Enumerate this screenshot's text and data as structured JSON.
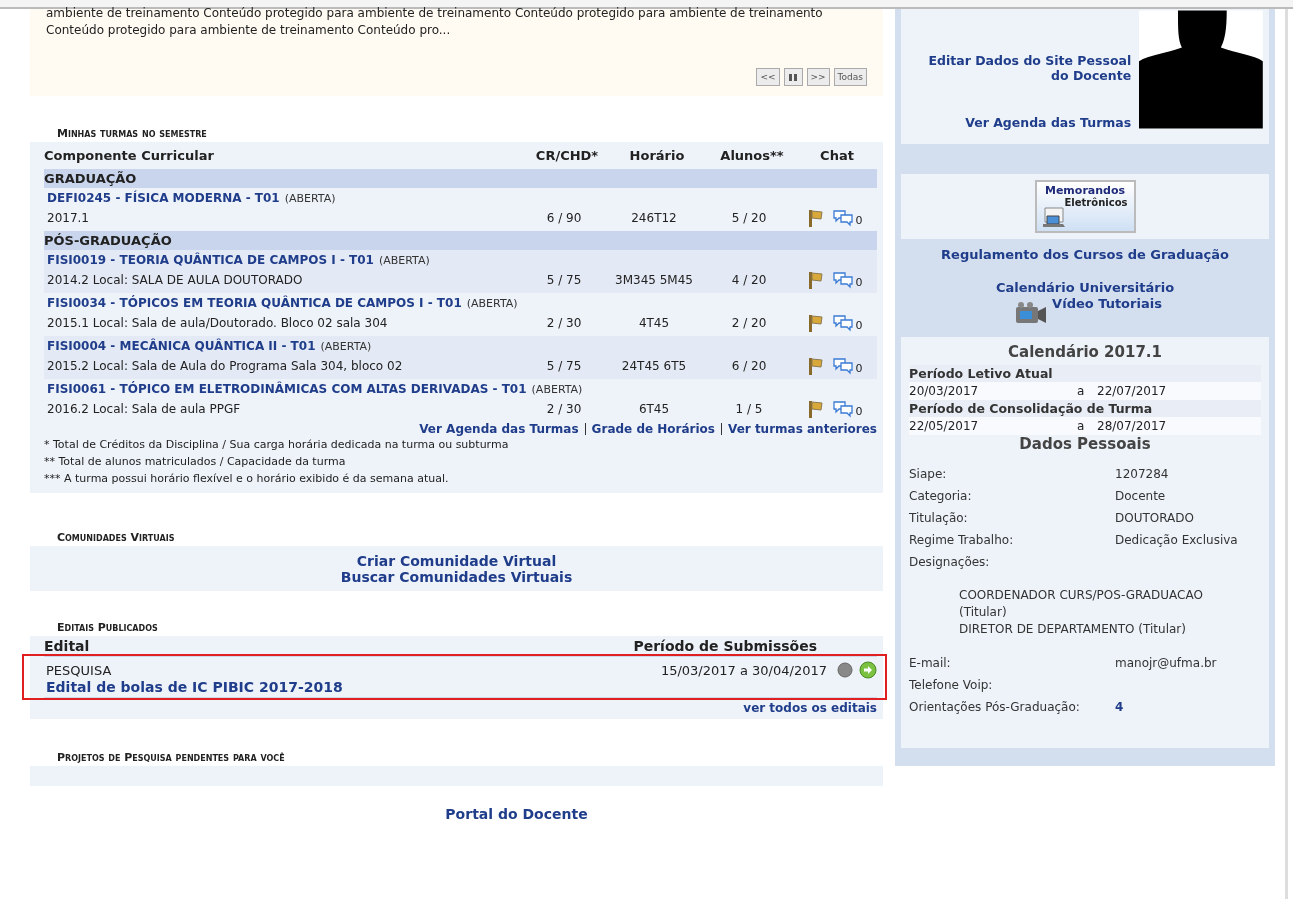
{
  "news": {
    "lines": [
      "ambiente de treinamento Conteúdo protegido para ambiente de treinamento Conteúdo protegido para ambiente de treinamento",
      "Conteúdo protegido para ambiente de treinamento Conteúdo pro..."
    ],
    "controls": [
      {
        "kind": "text",
        "label": "<<"
      },
      {
        "kind": "pause"
      },
      {
        "kind": "text",
        "label": ">>"
      },
      {
        "kind": "text",
        "label": "Todas"
      }
    ]
  },
  "turmas": {
    "title": "Minhas turmas no semestre",
    "columns": [
      "Componente Curricular",
      "CR/CHD*",
      "Horário",
      "Alunos**",
      "Chat"
    ],
    "groups": [
      {
        "name": "GRADUAÇÃO",
        "classes": [
          {
            "title": "DEFI0245 - FÍSICA MODERNA - T01",
            "status": "(ABERTA)",
            "location": "2017.1",
            "credits": "6 / 90",
            "schedule": "246T12",
            "students": "5 / 20",
            "chat_count": "0"
          }
        ]
      },
      {
        "name": "PÓS-GRADUAÇÃO",
        "classes": [
          {
            "title": "FISI0019 - TEORIA QUÂNTICA DE CAMPOS I - T01",
            "status": "(ABERTA)",
            "location": "2014.2 Local: SALA DE AULA DOUTORADO",
            "credits": "5 / 75",
            "schedule": "3M345 5M45",
            "students": "4 / 20",
            "chat_count": "0"
          },
          {
            "title": "FISI0034 - TÓPICOS EM TEORIA QUÂNTICA DE CAMPOS I - T01",
            "status": "(ABERTA)",
            "location": "2015.1 Local: Sala de aula/Doutorado. Bloco 02 sala 304",
            "credits": "2 / 30",
            "schedule": "4T45",
            "students": "2 / 20",
            "chat_count": "0"
          },
          {
            "title": "FISI0004 - MECÂNICA QUÂNTICA II - T01",
            "status": "(ABERTA)",
            "location": "2015.2 Local: Sala de Aula do Programa Sala 304, bloco 02",
            "credits": "5 / 75",
            "schedule": "24T45 6T5",
            "students": "6 / 20",
            "chat_count": "0"
          },
          {
            "title": "FISI0061 - TÓPICO EM ELETRODINÂMICAS COM ALTAS DERIVADAS - T01",
            "status": "(ABERTA)",
            "location": "2016.2 Local: Sala de aula PPGF",
            "credits": "2 / 30",
            "schedule": "6T45",
            "students": "1 / 5",
            "chat_count": "0"
          }
        ]
      }
    ],
    "links": [
      "Ver Agenda das Turmas",
      "Grade de Horários",
      "Ver turmas anteriores"
    ],
    "notes": [
      "* Total de Créditos da Disciplina / Sua carga horária dedicada na turma ou subturma",
      "** Total de alunos matriculados / Capacidade da turma",
      "*** A turma possui horário flexível e o horário exibido é da semana atual."
    ]
  },
  "comunidades": {
    "title": "Comunidades Virtuais",
    "links": [
      "Criar Comunidade Virtual",
      "Buscar Comunidades Virtuais"
    ]
  },
  "editais": {
    "title": "Editais Publicados",
    "columns": [
      "Edital",
      "Período de Submissões"
    ],
    "highlighted": true,
    "rows": [
      {
        "category": "PESQUISA",
        "period": "15/03/2017 a 30/04/2017",
        "name": "Edital de bolas de IC PIBIC 2017-2018"
      }
    ],
    "link": "ver todos os editais"
  },
  "projetos": {
    "title": "Projetos de Pesquisa pendentes para você"
  },
  "footer": {
    "link": "Portal do Docente"
  },
  "sidebar": {
    "profile_links": [
      "Editar Dados do Site Pessoal do Docente",
      "Ver Agenda das Turmas"
    ],
    "memorandos": [
      "Memorandos",
      "Eletrônicos"
    ],
    "links": [
      {
        "kind": "text",
        "label": "Regulamento dos Cursos de Graduação"
      },
      {
        "kind": "text",
        "label": "Calendário Universitário"
      },
      {
        "kind": "video",
        "label": "Vídeo Tutoriais"
      }
    ],
    "calendar": {
      "title": "Calendário 2017.1",
      "periods": [
        {
          "label": "Período Letivo Atual",
          "start": "20/03/2017",
          "sep": "a",
          "end": "22/07/2017"
        },
        {
          "label": "Período de Consolidação de Turma",
          "start": "22/05/2017",
          "sep": "a",
          "end": "28/07/2017"
        }
      ]
    },
    "personal": {
      "title": "Dados Pessoais",
      "fields": [
        {
          "label": "Siape:",
          "value": "1207284"
        },
        {
          "label": "Categoria:",
          "value": "Docente"
        },
        {
          "label": "Titulação:",
          "value": "DOUTORADO"
        },
        {
          "label": "Regime Trabalho:",
          "value": "Dedicação Exclusiva"
        },
        {
          "label": "Designações:"
        }
      ],
      "designations": [
        "COORDENADOR CURS/POS-GRADUACAO (Titular)",
        "DIRETOR DE DEPARTAMENTO (Titular)"
      ],
      "fields2": [
        {
          "label": "E-mail:",
          "value": "manojr@ufma.br",
          "kind": "text"
        },
        {
          "label": "Telefone Voip:"
        },
        {
          "label": "Orientações Pós-Graduação:",
          "value": "4",
          "kind": "link"
        }
      ]
    }
  }
}
